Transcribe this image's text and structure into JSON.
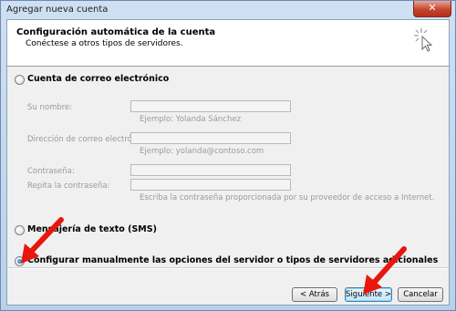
{
  "window": {
    "title": "Agregar nueva cuenta",
    "close_glyph": "✕"
  },
  "header": {
    "title": "Configuración automática de la cuenta",
    "subtitle": "Conéctese a otros tipos de servidores."
  },
  "options": {
    "email": {
      "label": "Cuenta de correo electrónico",
      "selected": false,
      "fields": {
        "name": {
          "label": "Su nombre:",
          "value": "",
          "hint": "Ejemplo: Yolanda Sánchez"
        },
        "email": {
          "label": "Dirección de correo electrónico:",
          "value": "",
          "hint": "Ejemplo: yolanda@contoso.com"
        },
        "password": {
          "label": "Contraseña:",
          "value": ""
        },
        "repeat": {
          "label": "Repita la contraseña:",
          "value": "",
          "hint": "Escriba la contraseña proporcionada por su proveedor de acceso a Internet."
        }
      }
    },
    "sms": {
      "label": "Mensajería de texto (SMS)",
      "selected": false
    },
    "manual": {
      "label": "Configurar manualmente las opciones del servidor o tipos de servidores adicionales",
      "selected": true
    }
  },
  "buttons": {
    "back": "< Atrás",
    "next": "Siguiente >",
    "cancel": "Cancelar"
  },
  "annotations": {
    "arrow_color": "#e8160c"
  }
}
